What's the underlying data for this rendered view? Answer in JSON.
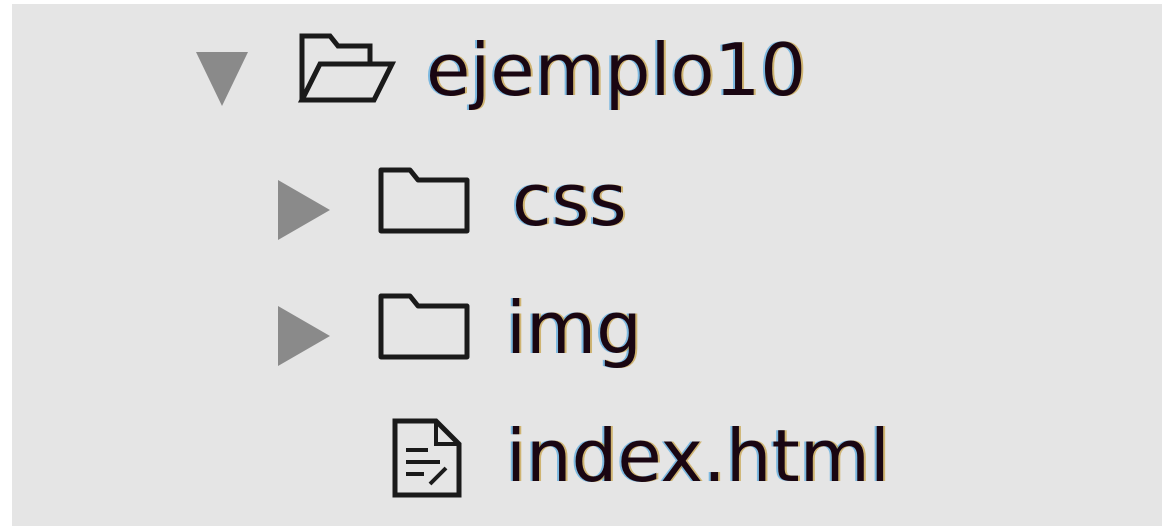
{
  "tree": {
    "root": {
      "label": "ejemplo10",
      "expanded": true,
      "icon": "folder-open-icon"
    },
    "children": [
      {
        "label": "css",
        "type": "folder",
        "expanded": false,
        "icon": "folder-icon"
      },
      {
        "label": "img",
        "type": "folder",
        "expanded": false,
        "icon": "folder-icon"
      },
      {
        "label": "index.html",
        "type": "file",
        "icon": "html-file-icon"
      }
    ]
  },
  "colors": {
    "background": "#e5e5e5",
    "text": "#1a0612",
    "twisty": "#8a8a8a",
    "icon_stroke": "#1a1a1a"
  }
}
